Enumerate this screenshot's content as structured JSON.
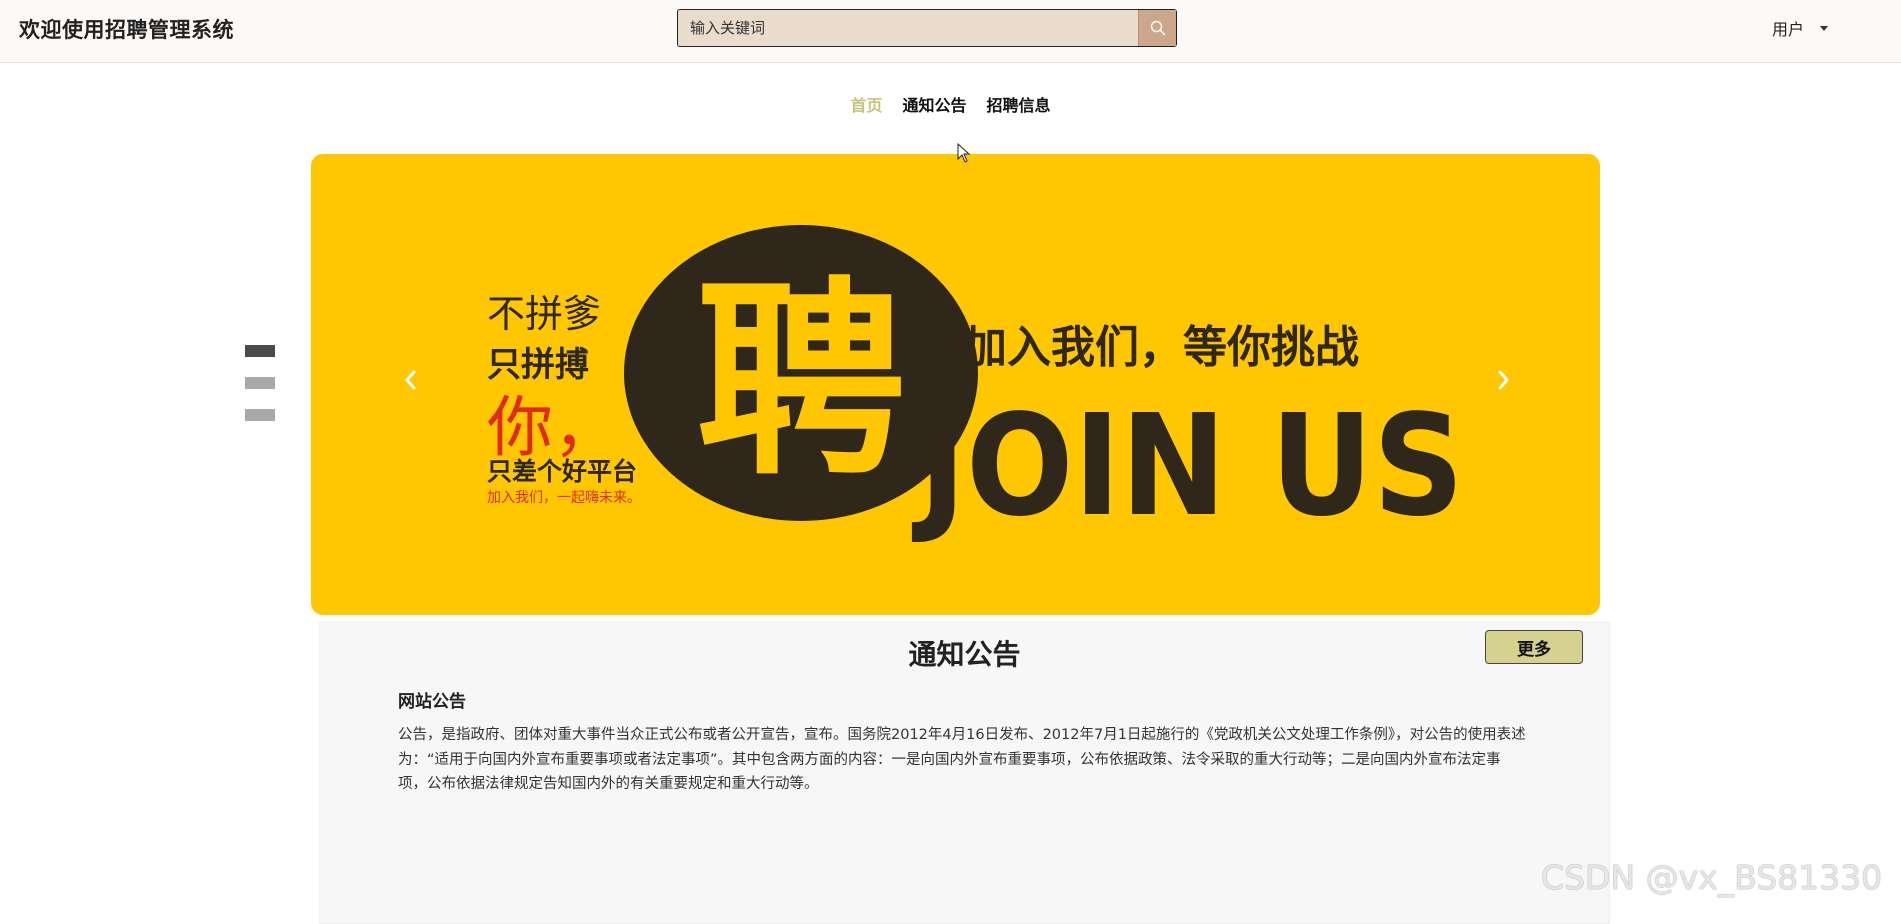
{
  "header": {
    "site_title": "欢迎使用招聘管理系统",
    "search_placeholder": "输入关键词",
    "search_icon": "search-icon",
    "user_label": "用户",
    "user_dropdown_icon": "caret-down-icon"
  },
  "nav": {
    "items": [
      {
        "label": "首页",
        "active": true
      },
      {
        "label": "通知公告",
        "active": false
      },
      {
        "label": "招聘信息",
        "active": false
      }
    ]
  },
  "carousel": {
    "slide_count": 3,
    "active_slide": 1,
    "banner": {
      "line1": "不拼爹",
      "line2": "只拼搏",
      "line3": "你，",
      "line4": "只差个好平台",
      "line5": "加入我们，一起嗨未来。",
      "headline": "加入我们，等你挑战",
      "join_us": "JOIN US",
      "logo_glyph": "聘",
      "colors": {
        "background": "#ffc701",
        "dark": "#2e271a",
        "red": "#e02a1a"
      }
    },
    "prev_icon": "chevron-left-icon",
    "next_icon": "chevron-right-icon"
  },
  "notice_section": {
    "title": "通知公告",
    "more_label": "更多",
    "notice": {
      "title": "网站公告",
      "body": "公告，是指政府、团体对重大事件当众正式公布或者公开宣告，宣布。国务院2012年4月16日发布、2012年7月1日起施行的《党政机关公文处理工作条例》，对公告的使用表述为：“适用于向国内外宣布重要事项或者法定事项”。其中包含两方面的内容：一是向国内外宣布重要事项，公布依据政策、法令采取的重大行动等；二是向国内外宣布法定事项，公布依据法律规定告知国内外的有关重要规定和重大行动等。"
    }
  },
  "watermark": "CSDN @vx_BS81330",
  "colors": {
    "header_bg": "#fdf9f6",
    "search_bg": "#e9dccd",
    "search_button": "#cda78c",
    "nav_active": "#c7c37c",
    "more_button": "#d5d18e"
  }
}
